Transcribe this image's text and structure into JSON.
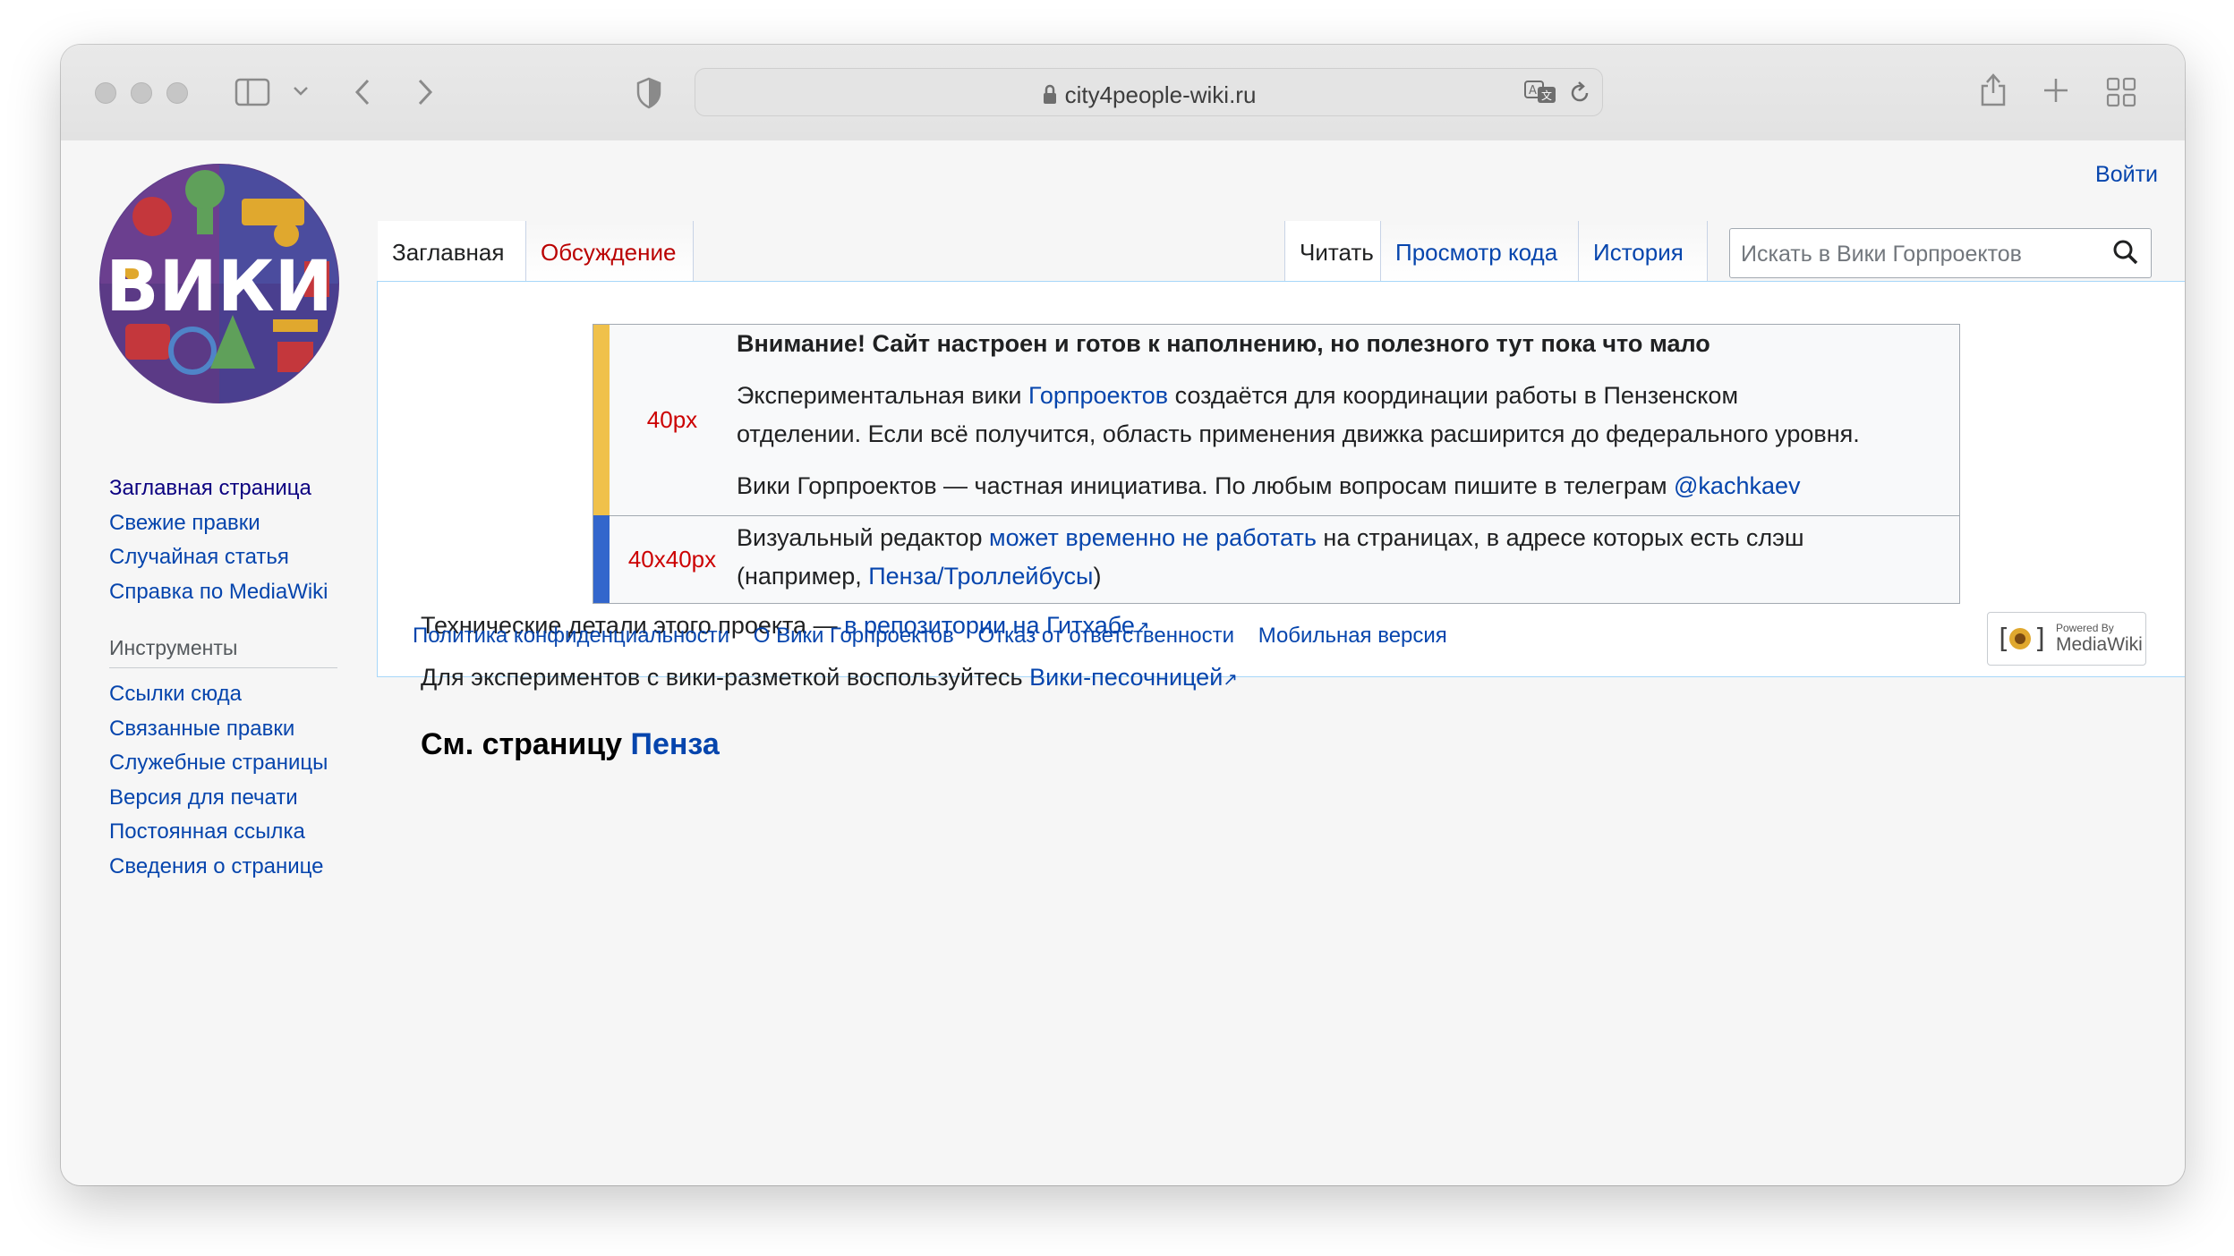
{
  "browser": {
    "url": "city4people-wiki.ru"
  },
  "header": {
    "logo_text": "ВИКИ",
    "login": "Войти"
  },
  "sidebar": {
    "nav": [
      "Заглавная страница",
      "Свежие правки",
      "Случайная статья",
      "Справка по MediaWiki"
    ],
    "tools_heading": "Инструменты",
    "tools": [
      "Ссылки сюда",
      "Связанные правки",
      "Служебные страницы",
      "Версия для печати",
      "Постоянная ссылка",
      "Сведения о странице"
    ]
  },
  "tabs": {
    "left": [
      "Заглавная",
      "Обсуждение"
    ],
    "right": [
      "Читать",
      "Просмотр кода",
      "История"
    ]
  },
  "search": {
    "placeholder": "Искать в Вики Горпроектов"
  },
  "notice": {
    "icon1_label": "40px",
    "bold": "Внимание! Сайт настроен и готов к наполнению, но полезного тут пока что мало",
    "p1_before": "Экспериментальная вики ",
    "p1_link": "Горпроектов",
    "p1_after1": " создаётся для координации работы в Пензенском",
    "p1_after2": "отделении. Если всё получится, область применения движка расширится до федерального уровня.",
    "p2_before": "Вики Горпроектов — частная инициатива. По любым вопросам пишите в телеграм ",
    "p2_link": "@kachkaev",
    "icon2_label": "40x40px",
    "r2_before": "Визуальный редактор ",
    "r2_link": "может временно не работать",
    "r2_after": " на страницах, в адресе которых есть слэш",
    "r2_line2_before": "(например, ",
    "r2_line2_link": "Пенза/Троллейбусы",
    "r2_line2_after": ")"
  },
  "content": {
    "tech_before": "Технические детали этого проекта — ",
    "tech_link": "в репозитории на Гитхабе",
    "sandbox_before": "Для экспериментов с вики-разметкой воспользуйтесь ",
    "sandbox_link": "Вики-песочницей",
    "see_prefix": "См. страницу ",
    "see_link": "Пенза"
  },
  "footer": {
    "links": [
      "Политика конфиденциальности",
      "О Вики Горпроектов",
      "Отказ от ответственности",
      "Мобильная версия"
    ],
    "powered_line1": "Powered By",
    "powered_line2": "MediaWiki"
  }
}
